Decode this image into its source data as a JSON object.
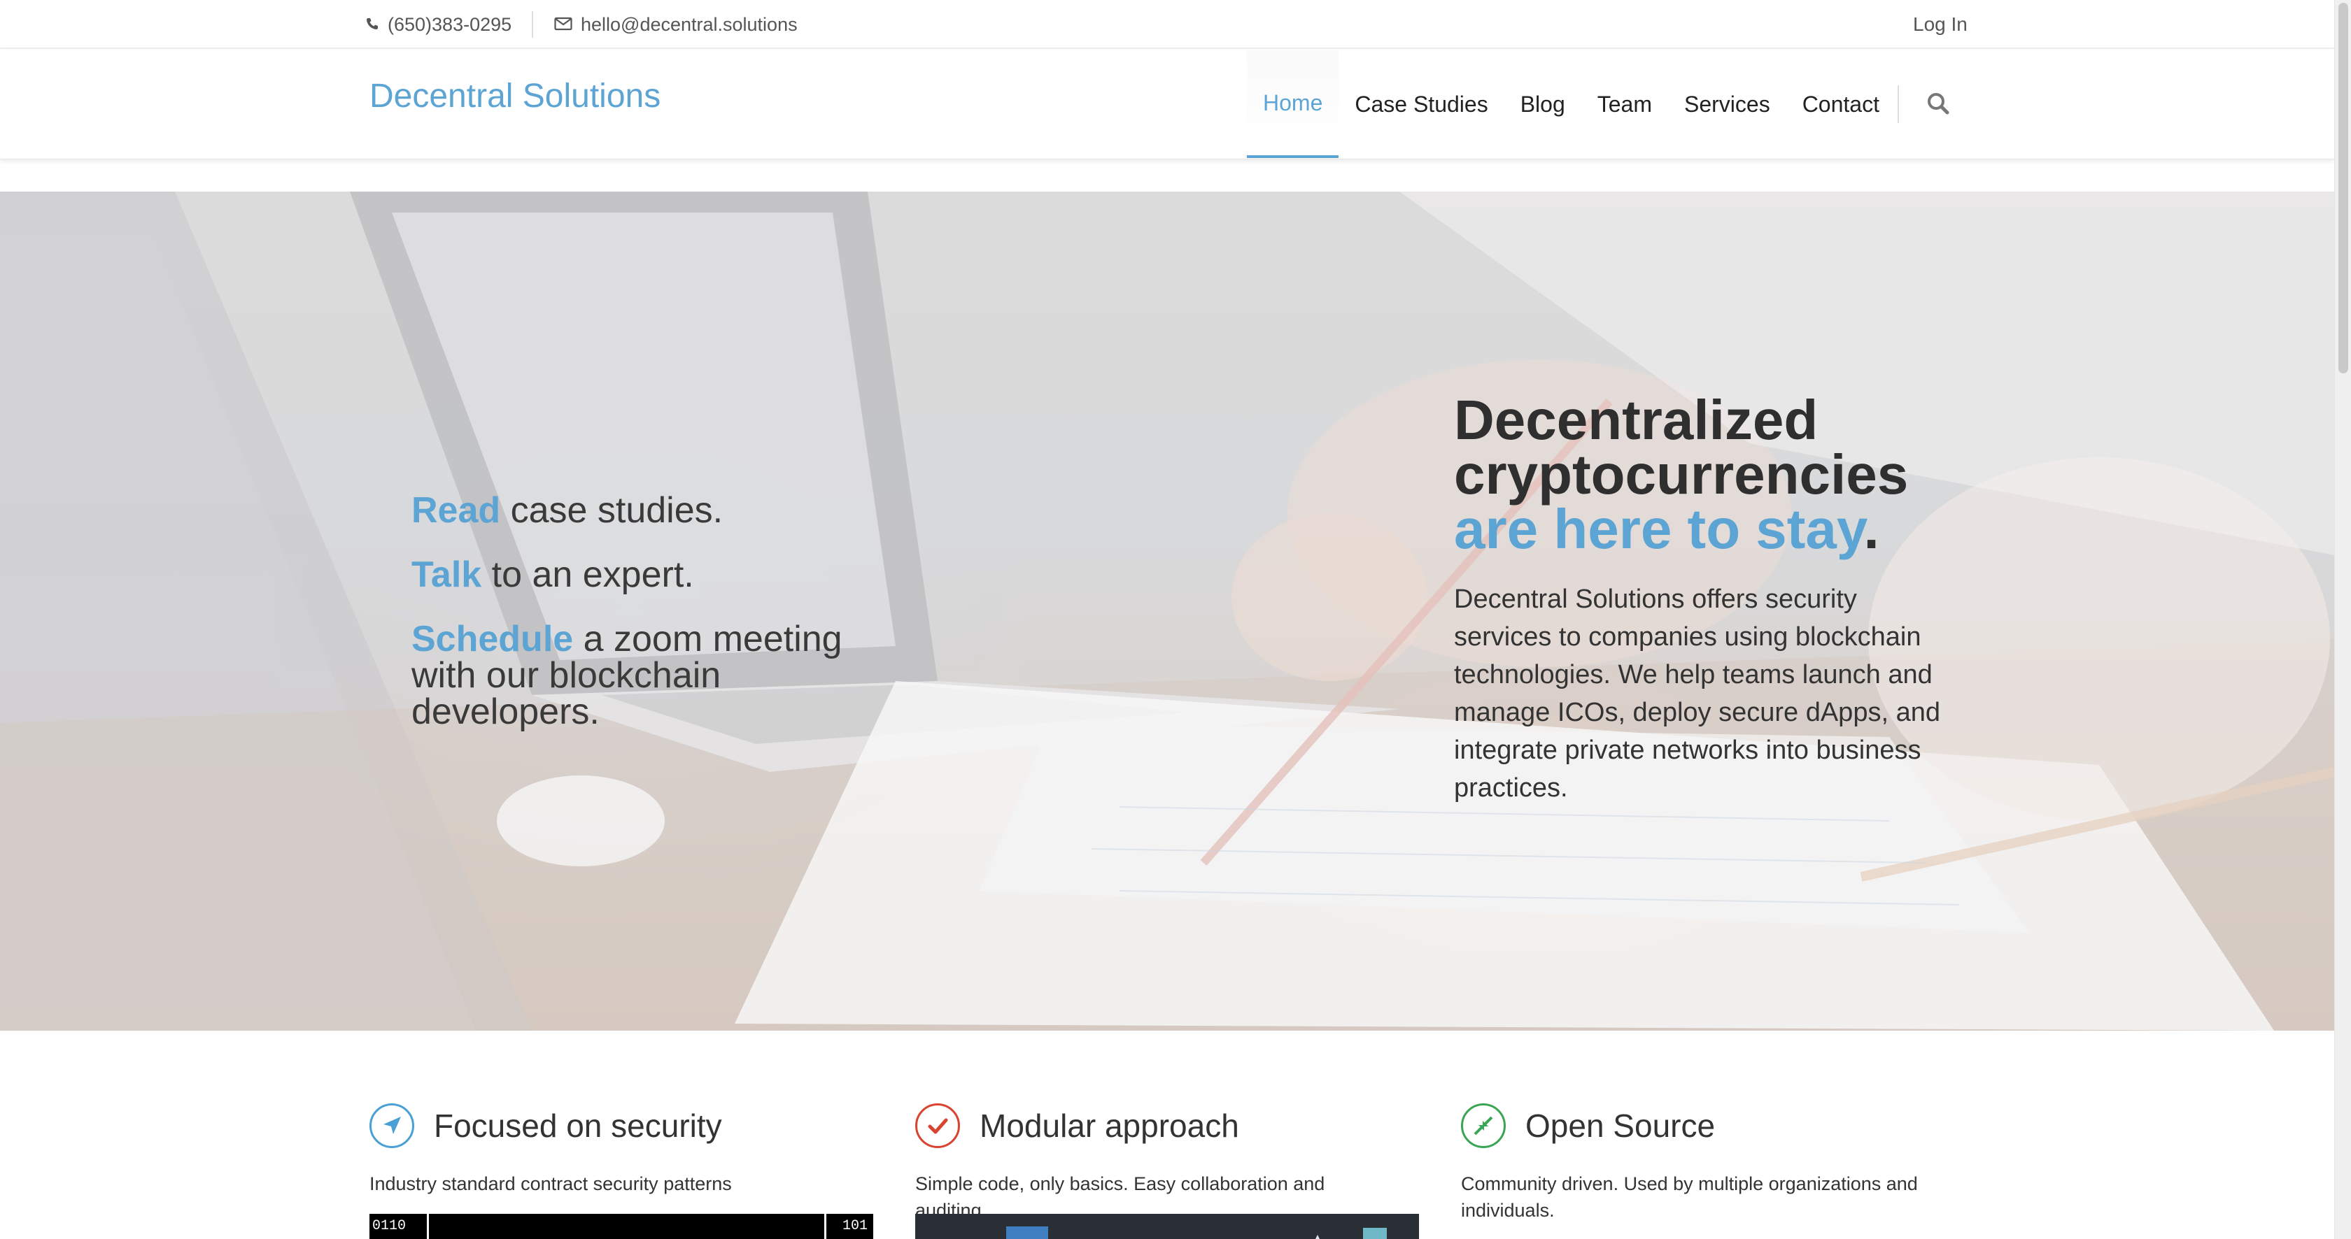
{
  "topbar": {
    "phone": "(650)383-0295",
    "email": "hello@decentral.solutions",
    "login": "Log In"
  },
  "header": {
    "brand": "Decentral Solutions",
    "nav": [
      {
        "label": "Home",
        "active": true
      },
      {
        "label": "Case Studies",
        "active": false
      },
      {
        "label": "Blog",
        "active": false
      },
      {
        "label": "Team",
        "active": false
      },
      {
        "label": "Services",
        "active": false
      },
      {
        "label": "Contact",
        "active": false
      }
    ],
    "search_icon": "search-icon"
  },
  "hero": {
    "cta": [
      {
        "highlight": "Read",
        "rest": " case studies."
      },
      {
        "highlight": "Talk",
        "rest": " to an expert."
      },
      {
        "highlight": "Schedule",
        "rest": " a zoom meeting with our blockchain developers."
      }
    ],
    "title_plain": "Decentralized cryptocurrencies ",
    "title_highlight": "are here to stay",
    "title_end": ".",
    "description": "Decentral Solutions offers security services to companies using blockchain technologies. We help teams launch and manage ICOs, deploy secure dApps, and integrate private networks into business practices."
  },
  "features": [
    {
      "icon": "navigation-arrow-icon",
      "color": "#4a9fd4",
      "title": "Focused on security",
      "text": "Industry standard contract security patterns"
    },
    {
      "icon": "checkmark-icon",
      "color": "#d9432f",
      "title": "Modular approach",
      "text": "Simple code, only basics. Easy collaboration and auditing."
    },
    {
      "icon": "compress-arrows-icon",
      "color": "#3aa655",
      "title": "Open Source",
      "text": "Community driven. Used by multiple organizations and individuals."
    }
  ],
  "colors": {
    "accent": "#5ba4d3",
    "text": "#333333"
  }
}
